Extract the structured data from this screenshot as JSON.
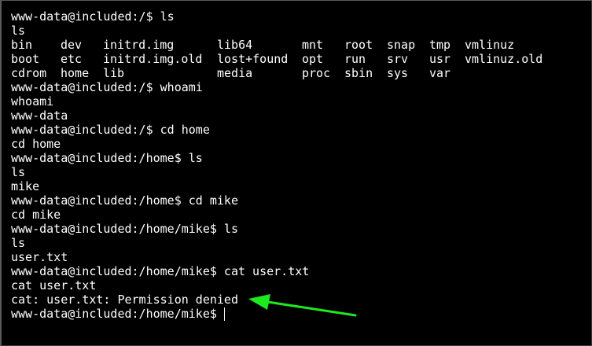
{
  "terminal": {
    "prompt_root": "www-data@included:/$ ls",
    "echo_ls": "ls",
    "ls_rows": [
      [
        "bin",
        "dev",
        "initrd.img",
        "lib64",
        "mnt",
        "root",
        "snap",
        "tmp",
        "vmlinuz"
      ],
      [
        "boot",
        "etc",
        "initrd.img.old",
        "lost+found",
        "opt",
        "run",
        "srv",
        "usr",
        "vmlinuz.old"
      ],
      [
        "cdrom",
        "home",
        "lib",
        "media",
        "proc",
        "sbin",
        "sys",
        "var"
      ]
    ],
    "cmd_whoami": "www-data@included:/$ whoami",
    "echo_whoami": "whoami",
    "out_whoami": "www-data",
    "cmd_cd_home": "www-data@included:/$ cd home",
    "echo_cd_home": "cd home",
    "cmd_ls_home": "www-data@included:/home$ ls",
    "echo_ls_home": "ls",
    "out_ls_home": "mike",
    "cmd_cd_mike": "www-data@included:/home$ cd mike",
    "echo_cd_mike": "cd mike",
    "cmd_ls_mike": "www-data@included:/home/mike$ ls",
    "echo_ls_mike": "ls",
    "out_ls_mike": "user.txt",
    "cmd_cat": "www-data@included:/home/mike$ cat user.txt",
    "echo_cat": "cat user.txt",
    "out_cat": "cat: user.txt: Permission denied",
    "current_prompt": "www-data@included:/home/mike$"
  },
  "colors": {
    "background": "#000000",
    "foreground": "#ffffff",
    "annotation_arrow": "#1ee81e"
  },
  "icons": {
    "annotation": "green-arrow-icon"
  }
}
